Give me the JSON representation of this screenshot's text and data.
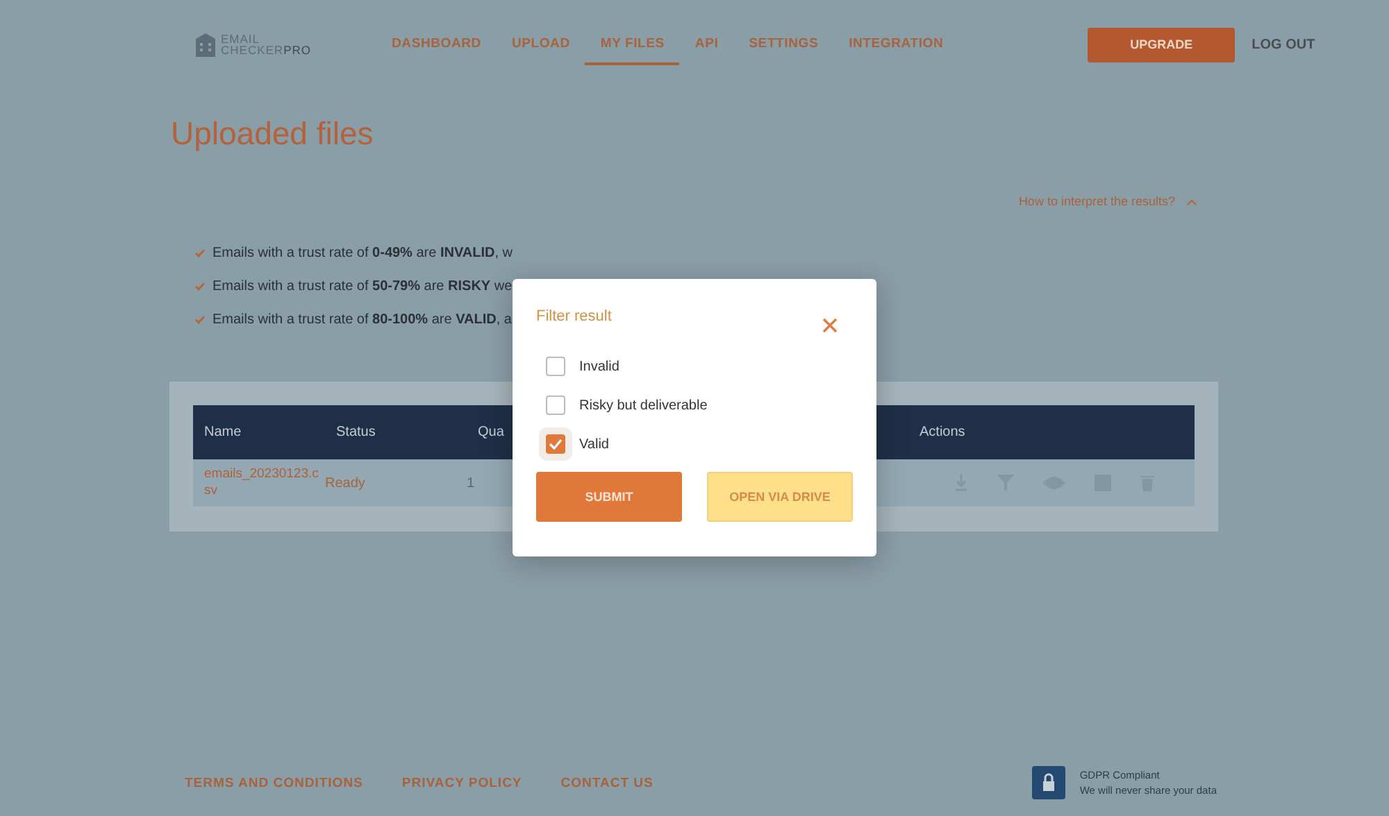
{
  "logo": {
    "line1": "EMAIL",
    "line2a": "CHECKER",
    "line2b": "PRO"
  },
  "nav": [
    {
      "label": "DASHBOARD",
      "selected": false
    },
    {
      "label": "UPLOAD",
      "selected": false
    },
    {
      "label": "MY FILES",
      "selected": true
    },
    {
      "label": "API",
      "selected": false
    },
    {
      "label": "SETTINGS",
      "selected": false
    },
    {
      "label": "INTEGRATION",
      "selected": false
    }
  ],
  "upgrade_button": "UPGRADE",
  "logout": "LOG OUT",
  "page_title": "Uploaded files",
  "interpret_link": "How to interpret the results?",
  "rules": [
    "Emails with a trust rate of **0-49%** are **INVALID**, w",
    "Emails with a trust rate of **50-79%** are **RISKY** we",
    "Emails with a trust rate of **80-100%** are **VALID**, a"
  ],
  "table": {
    "columns": [
      "Name",
      "Status",
      "Qua",
      "Actions"
    ],
    "rows": [
      {
        "name": "emails_20230123.csv",
        "status": "Ready",
        "column_3": "1"
      }
    ]
  },
  "dialog": {
    "title": "Filter result",
    "options": [
      {
        "label": "Invalid",
        "checked": false
      },
      {
        "label": "Risky but deliverable",
        "checked": false
      },
      {
        "label": "Valid",
        "checked": true
      }
    ],
    "submit": "SUBMIT",
    "drive": "OPEN VIA DRIVE"
  },
  "footer": {
    "links": [
      "TERMS AND CONDITIONS",
      "PRIVACY POLICY",
      "CONTACT US"
    ],
    "gdpr_title": "GDPR Compliant",
    "gdpr_text": "We will never share your data"
  }
}
